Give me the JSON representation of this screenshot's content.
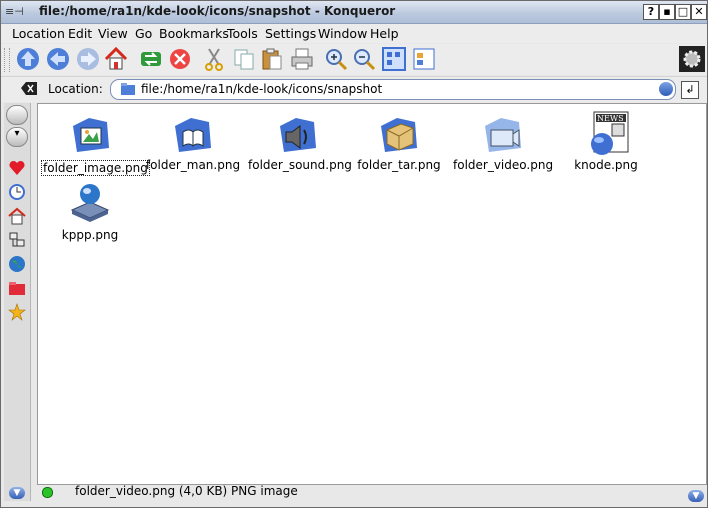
{
  "window": {
    "title": "file:/home/ra1n/kde-look/icons/snapshot - Konqueror",
    "title_icon": "pin-icon",
    "buttons": [
      "?",
      "▪",
      "□",
      "✕"
    ]
  },
  "menubar": {
    "items": [
      "Location",
      "Edit",
      "View",
      "Go",
      "Bookmarks",
      "Tools",
      "Settings",
      "Window",
      "Help"
    ]
  },
  "toolbar": {
    "icons": [
      "up-arrow-icon",
      "back-arrow-icon",
      "forward-arrow-icon",
      "home-icon",
      "reload-icon",
      "stop-icon",
      "cut-icon",
      "copy-icon",
      "paste-icon",
      "print-icon",
      "zoom-in-icon",
      "zoom-out-icon",
      "icon-view-icon",
      "split-view-icon",
      "konqueror-gear-icon"
    ]
  },
  "location": {
    "label": "Location:",
    "value": "file:/home/ra1n/kde-look/icons/snapshot"
  },
  "sidebar": {
    "icons": [
      "history-heart-icon",
      "clock-icon",
      "home-icon",
      "network-icon",
      "globe-icon",
      "folder-red-icon",
      "star-icon"
    ]
  },
  "files": [
    {
      "name": "folder_image.png",
      "icon": "folder-image-icon",
      "selected": true
    },
    {
      "name": "folder_man.png",
      "icon": "folder-man-icon",
      "selected": false
    },
    {
      "name": "folder_sound.png",
      "icon": "folder-sound-icon",
      "selected": false
    },
    {
      "name": "folder_tar.png",
      "icon": "folder-tar-icon",
      "selected": false
    },
    {
      "name": "folder_video.png",
      "icon": "folder-video-icon",
      "selected": false
    },
    {
      "name": "knode.png",
      "icon": "knode-news-icon",
      "selected": false
    },
    {
      "name": "kppp.png",
      "icon": "kppp-icon",
      "selected": false
    }
  ],
  "status": {
    "text": "folder_video.png (4,0 KB)  PNG image",
    "led_color": "#2ac42a"
  },
  "colors": {
    "accent": "#3f6fd0",
    "titlebar": "#bccadf"
  }
}
